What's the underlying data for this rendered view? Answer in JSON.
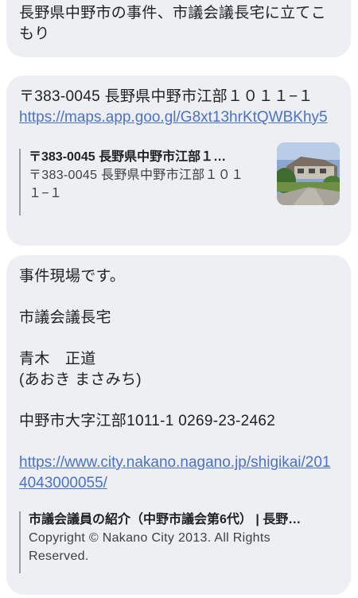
{
  "messages": {
    "m1": {
      "text": "長野県中野市の事件、市議会議長宅に立てこもり"
    },
    "m2": {
      "text": "〒383-0045 長野県中野市江部１０１１−１",
      "link": "https://maps.app.goo.gl/G8xt13hrKtQWBKhy5",
      "preview_title": "〒383-0045 長野県中野市江部１…",
      "preview_desc": "〒383-0045 長野県中野市江部１０１１−１"
    },
    "m3": {
      "text": "事件現場です。\n\n市議会議長宅\n\n青木　正道\n(あおき まさみち)\n\n中野市大字江部1011-1 0269-23-2462",
      "link": "https://www.city.nakano.nagano.jp/shigikai/2014043000055/",
      "preview_title": "市議会議員の紹介（中野市議会第6代） | 長野…",
      "preview_desc": "Copyright © Nakano City 2013. All Rights Reserved."
    }
  },
  "colors": {
    "bubble": "#eeeff3",
    "link": "#4a72c8"
  }
}
